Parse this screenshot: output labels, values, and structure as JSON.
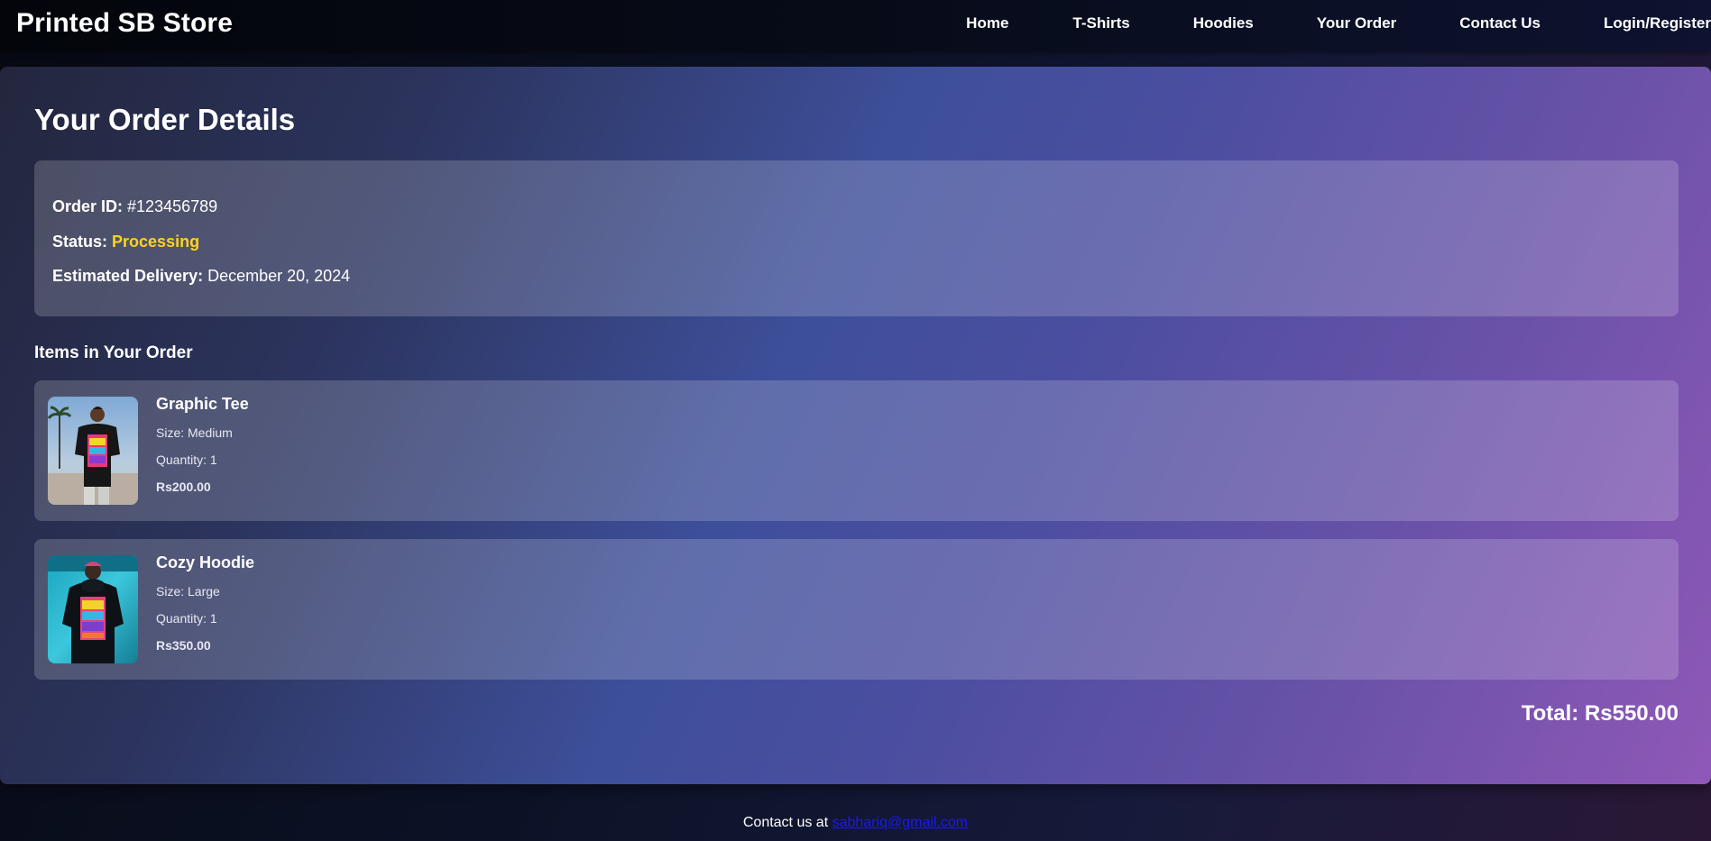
{
  "header": {
    "brand": "Printed SB Store",
    "nav": [
      {
        "label": "Home"
      },
      {
        "label": "T-Shirts"
      },
      {
        "label": "Hoodies"
      },
      {
        "label": "Your Order"
      },
      {
        "label": "Contact Us"
      },
      {
        "label": "Login/Register"
      }
    ]
  },
  "order": {
    "title": "Your Order Details",
    "id_label": "Order ID:",
    "id_value": "#123456789",
    "status_label": "Status:",
    "status_value": "Processing",
    "delivery_label": "Estimated Delivery:",
    "delivery_value": "December 20, 2024",
    "items_heading": "Items in Your Order",
    "items": [
      {
        "name": "Graphic Tee",
        "size": "Size: Medium",
        "quantity": "Quantity: 1",
        "price": "Rs200.00",
        "image": "man-in-black-graphic-tee"
      },
      {
        "name": "Cozy Hoodie",
        "size": "Size: Large",
        "quantity": "Quantity: 1",
        "price": "Rs350.00",
        "image": "man-in-black-graphic-hoodie"
      }
    ],
    "total": "Total: Rs550.00"
  },
  "footer": {
    "text": "Contact us at",
    "email": "sabhariq@gmail.com"
  },
  "colors": {
    "status_accent": "#ffd21f",
    "link": "#1a1aee"
  }
}
